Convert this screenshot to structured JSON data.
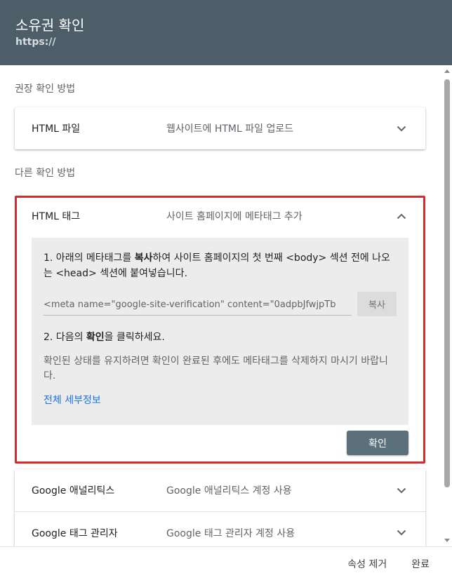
{
  "header": {
    "title": "소유권 확인",
    "subtitle": "https://"
  },
  "recommended": {
    "section_label": "권장 확인 방법",
    "method": {
      "name": "HTML 파일",
      "description": "웹사이트에 HTML 파일 업로드",
      "icon": "chevron-down-icon"
    }
  },
  "other": {
    "section_label": "다른 확인 방법",
    "html_tag": {
      "name": "HTML 태그",
      "description": "사이트 홈페이지에 메타태그 추가",
      "icon": "chevron-up-icon",
      "step1_prefix": "1. 아래의 메타태그를 ",
      "step1_bold": "복사",
      "step1_suffix": "하여 사이트 홈페이지의 첫 번째 <body> 섹션 전에 나오는 <head> 섹션에 붙여넣습니다.",
      "meta_value": "<meta name=\"google-site-verification\" content=\"0adpbJfwjpTb",
      "copy_label": "복사",
      "step2_prefix": "2. 다음의 ",
      "step2_bold": "확인",
      "step2_suffix": "을 클릭하세요.",
      "note": "확인된 상태를 유지하려면 확인이 완료된 후에도 메타태그를 삭제하지 마시기 바랍니다.",
      "details_link": "전체 세부정보",
      "confirm_label": "확인"
    },
    "more_methods": [
      {
        "name": "Google 애널리틱스",
        "description": "Google 애널리틱스 계정 사용",
        "icon": "chevron-down-icon"
      },
      {
        "name": "Google 태그 관리자",
        "description": "Google 태그 관리자 계정 사용",
        "icon": "chevron-down-icon"
      }
    ]
  },
  "footer": {
    "remove_label": "속성 제거",
    "done_label": "완료"
  },
  "colors": {
    "header_bg": "#4d5e69",
    "highlight_border": "#d62b2b",
    "link": "#1a73e8",
    "confirm_bg": "#5c707c"
  }
}
